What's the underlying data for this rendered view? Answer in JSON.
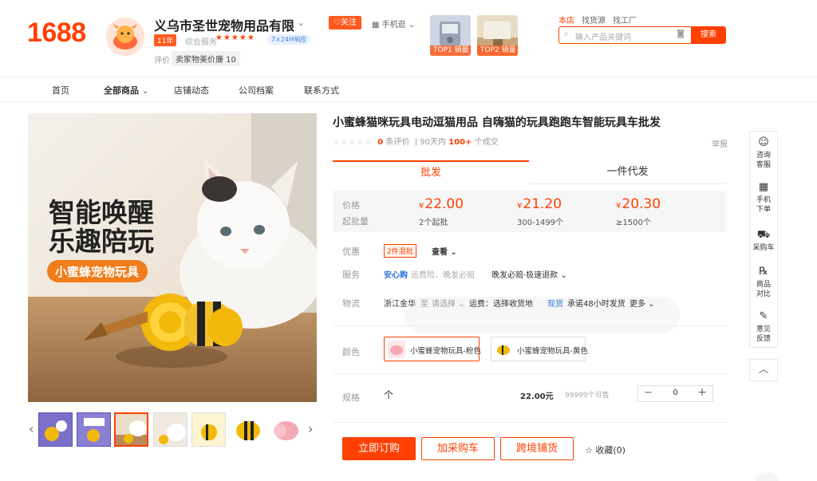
{
  "header": {
    "logo": "1688",
    "shop_name": "义乌市圣世宠物用品有限",
    "shop_badge": "11年",
    "score_label": "综合服务",
    "stars": "★★★★★",
    "service_tag": "7×24H响应",
    "eval_label": "评价",
    "eval_tag": "卖家物美价廉 10",
    "follow": "♡关注",
    "mobile": "手机逛",
    "top1": "TOP1 销量",
    "top2": "TOP2 销量",
    "search_tabs": [
      "本店",
      "找货源",
      "找工厂"
    ],
    "search_placeholder": "输入产品关键词",
    "search_button": "搜索"
  },
  "nav": {
    "items": [
      "首页",
      "全部商品",
      "店铺动态",
      "公司档案",
      "联系方式"
    ]
  },
  "product": {
    "title": "小蜜蜂猫咪玩具电动逗猫用品 自嗨猫的玩具跑跑车智能玩具车批发",
    "image_text_1": "智能唤醒",
    "image_text_2": "乐趣陪玩",
    "image_text_3": "小蜜蜂宠物玩具",
    "reviews_count": "0",
    "reviews_label": "条评价",
    "sold_prefix": "90天内",
    "sold_count": "100+",
    "sold_suffix": "个成交",
    "report": "举报"
  },
  "tabs": {
    "wholesale": "批发",
    "dropship": "一件代发"
  },
  "price": {
    "price_label": "价格",
    "moq_label": "起批量",
    "currency": "¥",
    "tiers": [
      {
        "price": "22.00",
        "moq": "2个起批"
      },
      {
        "price": "21.20",
        "moq": "300-1499个"
      },
      {
        "price": "20.30",
        "moq": "≥1500个"
      }
    ]
  },
  "details": {
    "discount_label": "优惠",
    "discount_tag": "2件混批",
    "view": "查看 ⌄",
    "service_label": "服务",
    "anxin": "安心购",
    "service_sub": "运费险、晚发必赔",
    "service_main": "晚发必赔·极速退款 ⌄",
    "logistics_label": "物流",
    "origin": "浙江金华",
    "to": "至",
    "choose": "请选择 ⌄",
    "freight": "运费：选择收货地",
    "in_stock": "现货",
    "promise": "承诺48小时发货",
    "more": "更多 ⌄",
    "color_label": "颜色",
    "colors": [
      "小蜜蜂宠物玩具-粉色",
      "小蜜蜂宠物玩具-黄色"
    ],
    "spec_label": "规格",
    "spec_value": "个",
    "spec_price": "22.00元",
    "spec_stock": "99999个可售",
    "qty": "0"
  },
  "actions": {
    "order": "立即订购",
    "cart": "加采购车",
    "crossborder": "跨境铺货",
    "favorite": "☆ 收藏(0)"
  },
  "sidebar": {
    "items": [
      {
        "icon": "☺",
        "label1": "咨询",
        "label2": "客服"
      },
      {
        "icon": "▦",
        "label1": "手机",
        "label2": "下单"
      },
      {
        "icon": "⛟",
        "label1": "采购车",
        "label2": ""
      },
      {
        "icon": "℞",
        "label1": "商品",
        "label2": "对比"
      },
      {
        "icon": "✎",
        "label1": "意见",
        "label2": "反馈"
      }
    ],
    "top": "︿"
  },
  "colors": {
    "brand": "#ff4000",
    "link": "#2b71d8"
  }
}
